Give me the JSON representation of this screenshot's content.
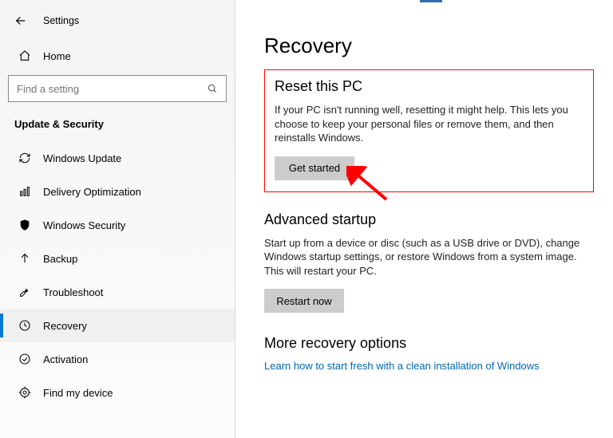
{
  "header": {
    "settings_label": "Settings"
  },
  "home": {
    "label": "Home"
  },
  "search": {
    "placeholder": "Find a setting"
  },
  "category": {
    "label": "Update & Security"
  },
  "nav": {
    "items": [
      {
        "label": "Windows Update",
        "icon": "sync-icon"
      },
      {
        "label": "Delivery Optimization",
        "icon": "optimize-icon"
      },
      {
        "label": "Windows Security",
        "icon": "shield-icon"
      },
      {
        "label": "Backup",
        "icon": "backup-icon"
      },
      {
        "label": "Troubleshoot",
        "icon": "troubleshoot-icon"
      },
      {
        "label": "Recovery",
        "icon": "recovery-icon"
      },
      {
        "label": "Activation",
        "icon": "activation-icon"
      },
      {
        "label": "Find my device",
        "icon": "locate-icon"
      }
    ],
    "selected_index": 5
  },
  "page": {
    "title": "Recovery",
    "reset": {
      "heading": "Reset this PC",
      "description": "If your PC isn't running well, resetting it might help. This lets you choose to keep your personal files or remove them, and then reinstalls Windows.",
      "button": "Get started"
    },
    "advanced": {
      "heading": "Advanced startup",
      "description": "Start up from a device or disc (such as a USB drive or DVD), change Windows startup settings, or restore Windows from a system image. This will restart your PC.",
      "button": "Restart now"
    },
    "more": {
      "heading": "More recovery options",
      "link": "Learn how to start fresh with a clean installation of Windows"
    }
  },
  "colors": {
    "accent": "#0078d4",
    "link": "#0066b4",
    "highlight": "#ff0000"
  }
}
